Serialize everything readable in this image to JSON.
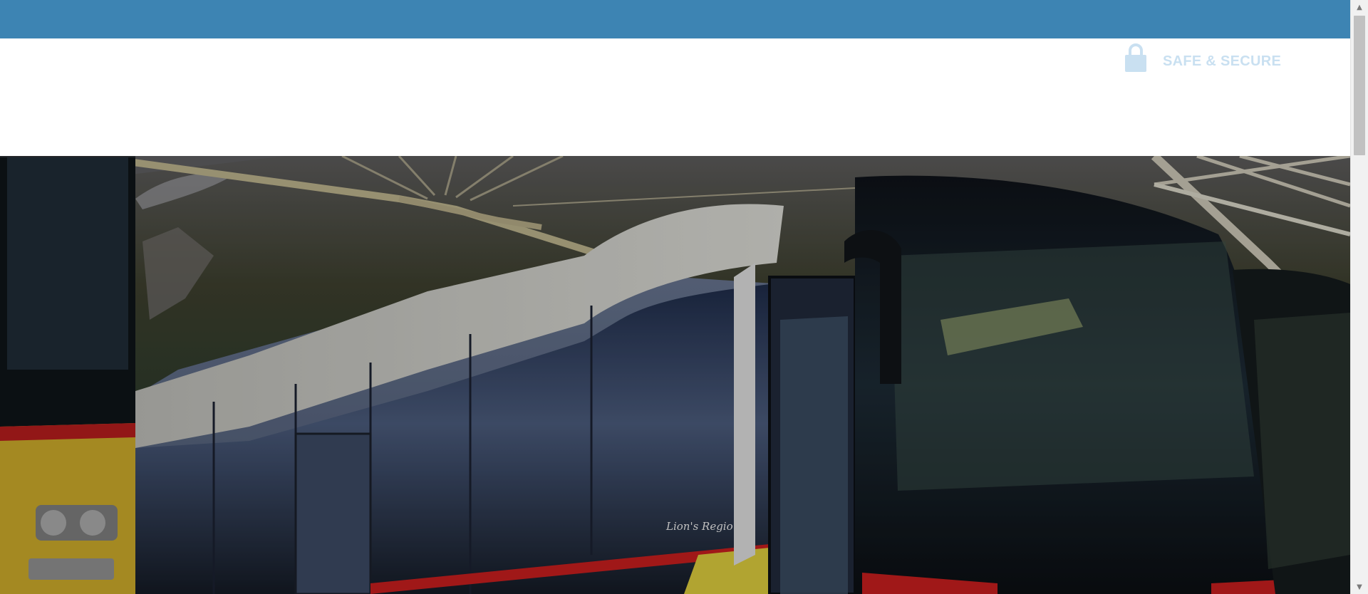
{
  "header": {
    "secure_badge": {
      "icon": "lock-icon",
      "label": "SAFE & SECURE",
      "color": "#c9e0f1"
    }
  },
  "topbar": {
    "color": "#3d84b3"
  },
  "hero": {
    "image": "bus-terminal-mountains",
    "bus_lettering": "Lion's Regio"
  },
  "scrollbar": {
    "up_glyph": "▲",
    "down_glyph": "▼"
  }
}
